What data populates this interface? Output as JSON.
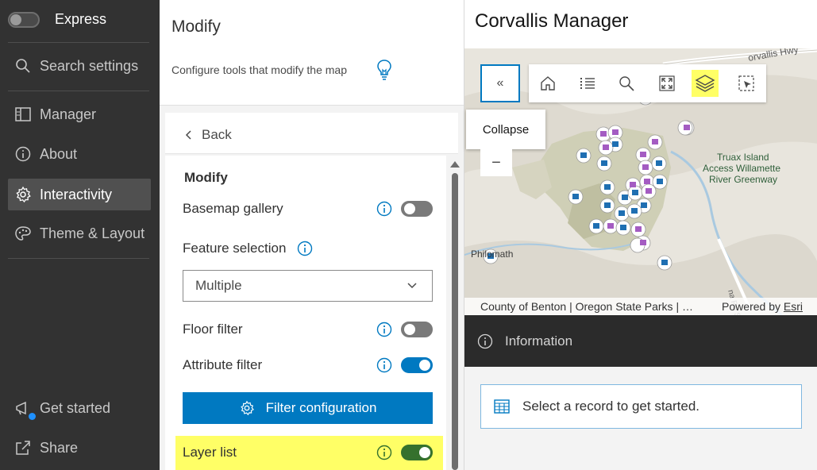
{
  "nav": {
    "express_label": "Express",
    "items": [
      {
        "label": "Search settings",
        "icon": "search-icon"
      },
      {
        "label": "Manager",
        "icon": "layout-icon"
      },
      {
        "label": "About",
        "icon": "info-icon"
      },
      {
        "label": "Interactivity",
        "icon": "gear-icon"
      },
      {
        "label": "Theme & Layout",
        "icon": "palette-icon"
      },
      {
        "label": "Get started",
        "icon": "megaphone-icon"
      },
      {
        "label": "Share",
        "icon": "share-icon"
      }
    ],
    "active_item": "Interactivity"
  },
  "panel": {
    "title": "Modify",
    "description": "Configure tools that modify the map",
    "back_label": "Back",
    "section_title": "Modify",
    "basemap_gallery": {
      "label": "Basemap gallery",
      "enabled": false
    },
    "feature_selection": {
      "label": "Feature selection",
      "value": "Multiple"
    },
    "floor_filter": {
      "label": "Floor filter",
      "enabled": false
    },
    "attribute_filter": {
      "label": "Attribute filter",
      "enabled": true
    },
    "filter_configuration_label": "Filter configuration",
    "layer_list": {
      "label": "Layer list",
      "enabled": true
    }
  },
  "preview": {
    "app_title": "Corvallis Manager",
    "collapse_label": "«",
    "tooltip": "Collapse",
    "zoom_out": "−",
    "map_labels": {
      "highway": "orvallis Hwy",
      "truax_1": "Truax Island",
      "truax_2": "Access Willamette",
      "truax_3": "River Greenway",
      "philomath": "Philomath",
      "road": "na Rd SW"
    },
    "attribution": "County of Benton | Oregon State Parks | …",
    "powered_by": "Powered by",
    "esri": "Esri",
    "info_label": "Information",
    "record_prompt": "Select a record to get started."
  },
  "colors": {
    "nav_bg": "#323232",
    "accent_blue": "#0079c1",
    "toggle_green": "#35712d",
    "highlight_yellow": "#ffff66",
    "info_bar_bg": "#2b2b2b"
  }
}
